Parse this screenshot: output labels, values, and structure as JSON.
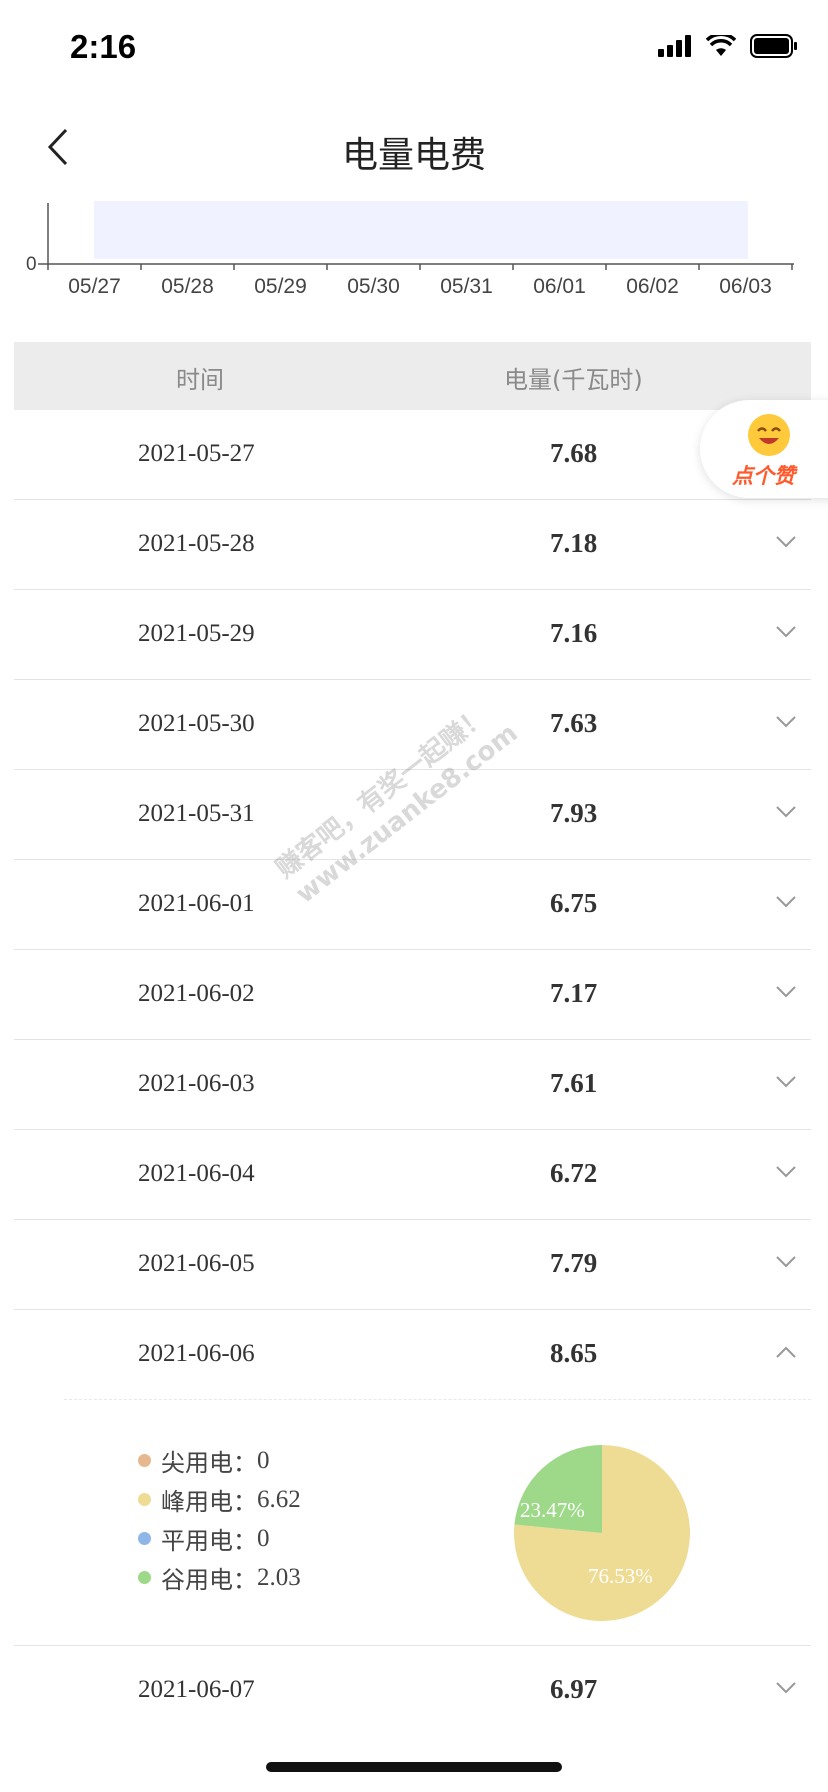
{
  "status_bar": {
    "time": "2:16"
  },
  "header": {
    "title": "电量电费"
  },
  "chart": {
    "zero_label": "0",
    "x_labels": [
      "05/27",
      "05/28",
      "05/29",
      "05/30",
      "05/31",
      "06/01",
      "06/02",
      "06/03"
    ],
    "band_color": "#f1f2ff"
  },
  "table": {
    "headers": {
      "time": "时间",
      "usage": "电量(千瓦时)"
    },
    "rows": [
      {
        "date": "2021-05-27",
        "value": "7.68"
      },
      {
        "date": "2021-05-28",
        "value": "7.18"
      },
      {
        "date": "2021-05-29",
        "value": "7.16"
      },
      {
        "date": "2021-05-30",
        "value": "7.63"
      },
      {
        "date": "2021-05-31",
        "value": "7.93"
      },
      {
        "date": "2021-06-01",
        "value": "6.75"
      },
      {
        "date": "2021-06-02",
        "value": "7.17"
      },
      {
        "date": "2021-06-03",
        "value": "7.61"
      },
      {
        "date": "2021-06-04",
        "value": "6.72"
      },
      {
        "date": "2021-06-05",
        "value": "7.79"
      },
      {
        "date": "2021-06-06",
        "value": "8.65"
      }
    ],
    "last_row": {
      "date": "2021-06-07",
      "value": "6.97"
    }
  },
  "detail": {
    "legend": [
      {
        "label": "尖用电：",
        "value": "0",
        "color": "#e6b88f"
      },
      {
        "label": "峰用电：",
        "value": "6.62",
        "color": "#eedc94"
      },
      {
        "label": "平用电：",
        "value": "0",
        "color": "#8fb6e8"
      },
      {
        "label": "谷用电：",
        "value": "2.03",
        "color": "#9ed889"
      }
    ],
    "pie_labels": {
      "valley": "23.47%",
      "peak": "76.53%"
    }
  },
  "chart_data": {
    "type": "pie",
    "categories": [
      "峰用电",
      "谷用电"
    ],
    "values": [
      76.53,
      23.47
    ],
    "colors": [
      "#eedc94",
      "#9ed889"
    ]
  },
  "like_button": {
    "label": "点个赞"
  },
  "watermark": {
    "line1": "赚客吧，有奖一起赚！",
    "line2": "www.zuanke8.com"
  }
}
